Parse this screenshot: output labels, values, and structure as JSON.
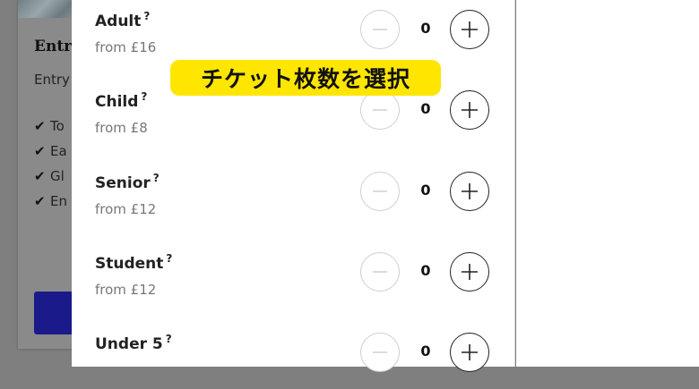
{
  "background_card": {
    "title": "Entr",
    "subtitle": "Entry",
    "features": [
      "To",
      "Ea",
      "Gl",
      "En"
    ]
  },
  "tickets": [
    {
      "name": "Adult",
      "help": "?",
      "price": "from £16",
      "qty": "0"
    },
    {
      "name": "Child",
      "help": "?",
      "price": "from £8",
      "qty": "0"
    },
    {
      "name": "Senior",
      "help": "?",
      "price": "from £12",
      "qty": "0"
    },
    {
      "name": "Student",
      "help": "?",
      "price": "from £12",
      "qty": "0"
    },
    {
      "name": "Under 5",
      "help": "?",
      "price": "",
      "qty": "0"
    }
  ],
  "annotation": {
    "text": "チケット枚数を選択"
  },
  "colors": {
    "overlay": "#7f7f7f",
    "panel": "#ffffff",
    "annotation_bg": "#ffe600",
    "button_primary": "#1a1a8a",
    "minus_disabled": "#cfcfcf",
    "plus_active": "#222222"
  }
}
